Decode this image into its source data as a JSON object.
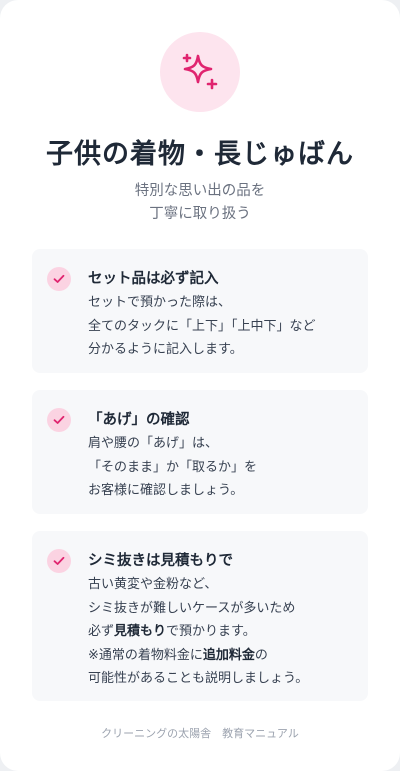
{
  "header": {
    "icon": "sparkles-icon",
    "title": "子供の着物・長じゅばん",
    "subtitle_line1": "特別な思い出の品を",
    "subtitle_line2": "丁寧に取り扱う"
  },
  "colors": {
    "accent": "#e0246f",
    "accent_bg": "#fde4ee",
    "check_bg": "#fbd3e2",
    "item_bg": "#f7f8fa"
  },
  "items": [
    {
      "icon": "check-icon",
      "title": "セット品は必ず記入",
      "line1": "セットで預かった際は、",
      "line2": "全てのタックに「上下」「上中下」など",
      "line3": "分かるように記入します。"
    },
    {
      "icon": "check-icon",
      "title": "「あげ」の確認",
      "line1": "肩や腰の「あげ」は、",
      "line2": "「そのまま」か「取るか」を",
      "line3": "お客様に確認しましょう。"
    },
    {
      "icon": "check-icon",
      "title": "シミ抜きは見積もりで",
      "line1": "古い黄変や金粉など、",
      "line2": "シミ抜きが難しいケースが多いため",
      "line3_pre": "必ず",
      "line3_bold": "見積もり",
      "line3_post": "で預かります。",
      "line4_pre": "※通常の着物料金に",
      "line4_bold": "追加料金",
      "line4_post": "の",
      "line5": "可能性があることも説明しましょう。"
    }
  ],
  "footer": {
    "text": "クリーニングの太陽舎　教育マニュアル"
  }
}
